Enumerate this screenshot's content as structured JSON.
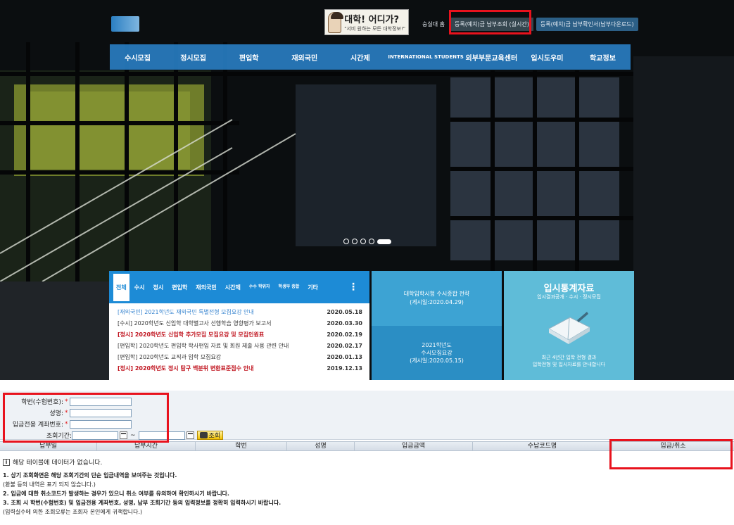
{
  "header": {
    "badge_title": "대학! 어디가?",
    "badge_sub": "\"서비 원하는 모든 대학정보!\"",
    "links": [
      "숭실대 홈",
      "등록(예치)금 납부조회 (실시간)",
      "등록(예치)금 납부확인서(납부다운로드)"
    ]
  },
  "gnb": {
    "items": [
      "수시모집",
      "정시모집",
      "편입학",
      "재외국민",
      "시간제",
      "INTERNATIONAL STUDENTS",
      "외부부문교육센터",
      "입시도우미",
      "학교정보"
    ]
  },
  "news": {
    "tabs": [
      "전체",
      "수시",
      "정시",
      "편입학",
      "재외국민",
      "시간제",
      "수수 학위자",
      "학생부 종합",
      "기타"
    ],
    "rows": [
      {
        "title": "[재외국민] 2021학년도 재외국민 특별전형 모집요강 안내",
        "date": "2020.05.18",
        "style": "blue"
      },
      {
        "title": "[수시] 2020학년도 신입학 대학별고사 선행학습 영향평가 보고서",
        "date": "2020.03.30",
        "style": ""
      },
      {
        "title": "[정시] 2020학년도 신입학 추가모집 모집요강 및 모집인원표",
        "date": "2020.02.19",
        "style": "hl"
      },
      {
        "title": "[편입학] 2020학년도 편입학 학사편입 자료 및 회원 제출 사용 관련 안내",
        "date": "2020.02.17",
        "style": ""
      },
      {
        "title": "[편입학] 2020학년도 교직과 입학 모집요강",
        "date": "2020.01.13",
        "style": ""
      },
      {
        "title": "[정시] 2020학년도 정시 탐구 백분위 변환표준점수 안내",
        "date": "2019.12.13",
        "style": "hl"
      }
    ]
  },
  "tiles": {
    "a": "대학입학시험 수시종합 전략\n(게시일:2020.04.29)",
    "b": "2021학년도\n수시모집요강\n(게시일:2020.05.15)",
    "c_title": "입시통계자료",
    "c_sub": "입시결과공개 · 수시 · 정시모집",
    "c_desc": "최근 4년간 입학 전형 결과\n입학전형 및 입시자료를 안내합니다"
  },
  "form": {
    "student_no_label": "학번(수험번호):",
    "name_label": "성명:",
    "account_label": "입금전용 계좌번호:",
    "period_label": "조회기간:",
    "required_mark": "*",
    "tilde": "~",
    "search_button": "조회"
  },
  "grid": {
    "columns": [
      "납부일",
      "납부시간",
      "학번",
      "성명",
      "입금금액",
      "수납코드명",
      "입금/취소"
    ],
    "empty_icon": "i",
    "empty_message": "해당 테이블에 데이터가 없습니다."
  },
  "notes": [
    {
      "text": "1. 상기 조회화면은 해당 조회기간의 단순 입금내역을 보여주는 것입니다.",
      "bold": true
    },
    {
      "text": "(환불 등의 내역은 표기 되지 않습니다.)",
      "bold": false
    },
    {
      "text": "2. 입금에 대한 취소코드가 발생하는 경우가 있으니 취소 여부를 유의하여 확인하시기 바랍니다.",
      "bold": true
    },
    {
      "text": "3. 조회 시 학번(수험번호) 및 입금전용 계좌번호, 성명, 납부 조회기간 등의 입력정보를 정확히 입력하시기 바랍니다.",
      "bold": true
    },
    {
      "text": "(입력실수에 의한 조회오류는 조회자 본인에게 귀책합니다.)",
      "bold": false
    }
  ],
  "colors": {
    "highlight": "#e8121d",
    "gnb": "#2c8ad7",
    "news_tab": "#1d8bd6"
  }
}
